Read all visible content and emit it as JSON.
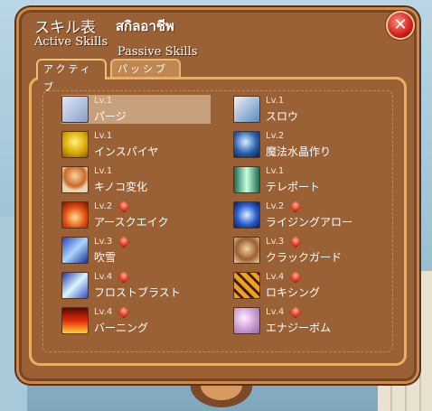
{
  "window": {
    "title_jp": "スキル表",
    "title_th": "สกิลอาชีพ",
    "label_active": "Active Skills",
    "label_passive": "Passive Skills",
    "close_symbol": "✕"
  },
  "tabs": [
    {
      "label": "アクティブ",
      "state": "selected"
    },
    {
      "label": "パッシブ",
      "state": "unselected"
    }
  ],
  "skills": [
    {
      "level": "Lv.1",
      "name": "パージ",
      "icon": "feather-icon",
      "has_gem": false,
      "selected": true
    },
    {
      "level": "Lv.1",
      "name": "スロウ",
      "icon": "hourglass-icon",
      "has_gem": false
    },
    {
      "level": "Lv.1",
      "name": "インスパイヤ",
      "icon": "lightbulb-icon",
      "has_gem": false
    },
    {
      "level": "Lv.2",
      "name": "魔法水晶作り",
      "icon": "crystal-ball-icon",
      "has_gem": false
    },
    {
      "level": "Lv.1",
      "name": "キノコ変化",
      "icon": "mushroom-icon",
      "has_gem": false
    },
    {
      "level": "Lv.1",
      "name": "テレポート",
      "icon": "teleport-beam-icon",
      "has_gem": false
    },
    {
      "level": "Lv.2",
      "name": "アースクエイク",
      "icon": "earthquake-icon",
      "has_gem": true
    },
    {
      "level": "Lv.2",
      "name": "ライジングアロー",
      "icon": "rising-arrow-icon",
      "has_gem": true
    },
    {
      "level": "Lv.3",
      "name": "吹雪",
      "icon": "blizzard-icon",
      "has_gem": true
    },
    {
      "level": "Lv.3",
      "name": "クラックガード",
      "icon": "crack-guard-icon",
      "has_gem": true
    },
    {
      "level": "Lv.4",
      "name": "フロストブラスト",
      "icon": "frost-blast-icon",
      "has_gem": true
    },
    {
      "level": "Lv.4",
      "name": "ロキシング",
      "icon": "lock-sing-icon",
      "has_gem": true
    },
    {
      "level": "Lv.4",
      "name": "バーニング",
      "icon": "burning-icon",
      "has_gem": true
    },
    {
      "level": "Lv.4",
      "name": "エナジーボム",
      "icon": "energy-bomb-icon",
      "has_gem": true
    }
  ],
  "colors": {
    "window_bg": "#9a6036",
    "border_light": "#e8b060",
    "gem": "#e0402a",
    "close": "#d0201a"
  }
}
